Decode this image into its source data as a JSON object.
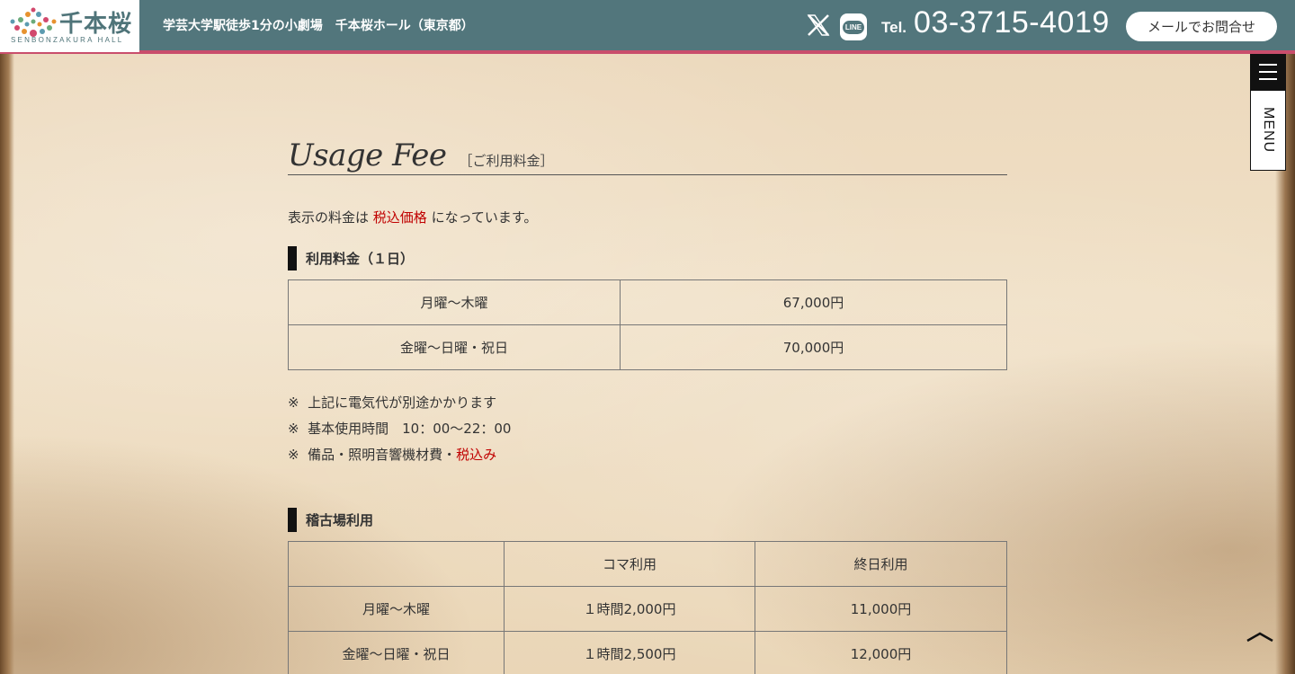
{
  "header": {
    "logo_kanji": "千本桜",
    "logo_roman": "SENBONZAKURA HALL",
    "tagline": "学芸大学駅徒歩1分の小劇場　千本桜ホール（東京都）",
    "tel_label": "Tel.",
    "tel_number": "03-3715-4019",
    "mail_button": "メールでお問合せ",
    "line_label": "LINE"
  },
  "menu": {
    "label": "MENU"
  },
  "section": {
    "title_en": "Usage Fee",
    "title_ja": "［ご利用料金］"
  },
  "intro": {
    "prefix": "表示の料金は ",
    "highlight": "税込価格",
    "suffix": " になっています。"
  },
  "daily_fee": {
    "heading": "利用料金（１日）",
    "rows": [
      {
        "day": "月曜〜木曜",
        "price": "67,000円"
      },
      {
        "day": "金曜〜日曜・祝日",
        "price": "70,000円"
      }
    ]
  },
  "notes": {
    "note1": "※  上記に電気代が別途かかります",
    "note2": "※  基本使用時間　10：00〜22：00",
    "note3_prefix": "※  備品・照明音響機材費・",
    "note3_highlight": "税込み"
  },
  "rehearsal": {
    "heading": "稽古場利用",
    "header_row": {
      "blank": "",
      "koma": "コマ利用",
      "allday": "終日利用"
    },
    "rows": [
      {
        "day": "月曜〜木曜",
        "koma": "１時間2,000円",
        "allday": "11,000円"
      },
      {
        "day": "金曜〜日曜・祝日",
        "koma": "１時間2,500円",
        "allday": "12,000円"
      }
    ]
  },
  "colors": {
    "header_bg": "#52767c",
    "header_accent": "#c94e6c",
    "highlight_red": "#c00000"
  },
  "icons": [
    "logo-sun-icon",
    "x-icon",
    "line-icon",
    "menu-hamburger-icon",
    "chevron-up-icon"
  ]
}
